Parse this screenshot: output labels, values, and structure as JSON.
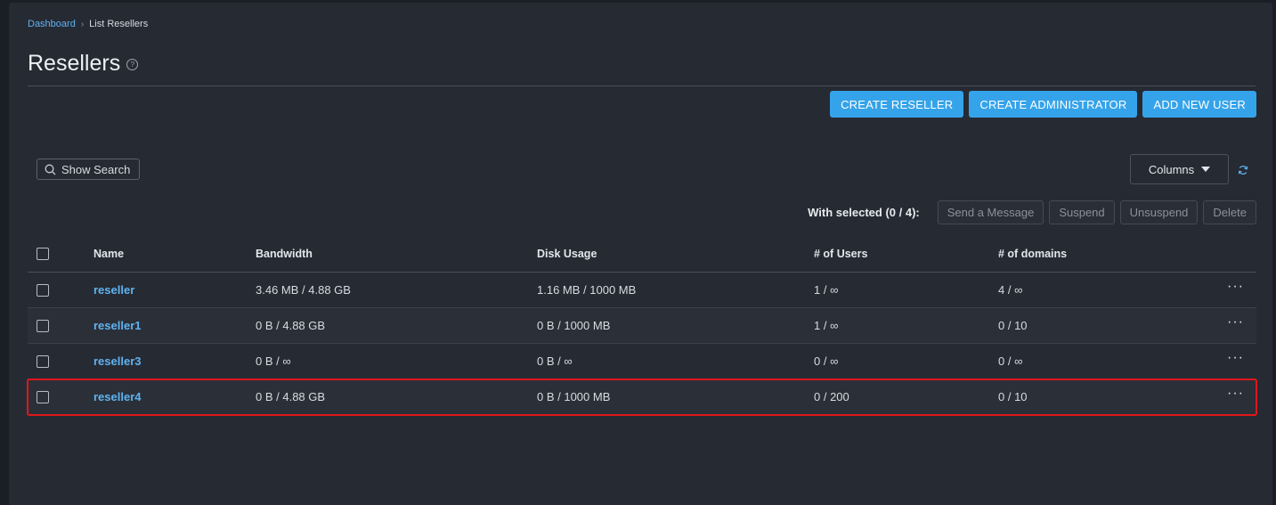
{
  "breadcrumb": {
    "home": "Dashboard",
    "separator": "›",
    "current": "List Resellers"
  },
  "page": {
    "title": "Resellers",
    "help_icon": "?"
  },
  "actions": {
    "create_reseller": "CREATE RESELLER",
    "create_administrator": "CREATE ADMINISTRATOR",
    "add_new_user": "ADD NEW USER"
  },
  "toolbar": {
    "show_search": "Show Search",
    "columns": "Columns"
  },
  "bulk": {
    "label": "With selected (0 / 4):",
    "send_message": "Send a Message",
    "suspend": "Suspend",
    "unsuspend": "Unsuspend",
    "delete": "Delete"
  },
  "table": {
    "headers": {
      "name": "Name",
      "bandwidth": "Bandwidth",
      "disk_usage": "Disk Usage",
      "users": "# of Users",
      "domains": "# of domains"
    },
    "rows": [
      {
        "name": "reseller",
        "bandwidth": "3.46 MB / 4.88 GB",
        "disk": "1.16 MB / 1000 MB",
        "users": "1 / ∞",
        "domains": "4 / ∞",
        "more": "···"
      },
      {
        "name": "reseller1",
        "bandwidth": "0 B / 4.88 GB",
        "disk": "0 B / 1000 MB",
        "users": "1 / ∞",
        "domains": "0 / 10",
        "more": "···"
      },
      {
        "name": "reseller3",
        "bandwidth": "0 B / ∞",
        "disk": "0 B / ∞",
        "users": "0 / ∞",
        "domains": "0 / ∞",
        "more": "···"
      },
      {
        "name": "reseller4",
        "bandwidth": "0 B / 4.88 GB",
        "disk": "0 B / 1000 MB",
        "users": "0 / 200",
        "domains": "0 / 10",
        "more": "···"
      }
    ]
  },
  "colors": {
    "accent": "#35a3ea",
    "link": "#5fb3f0",
    "highlight": "#e0161b",
    "background": "#262a33"
  }
}
